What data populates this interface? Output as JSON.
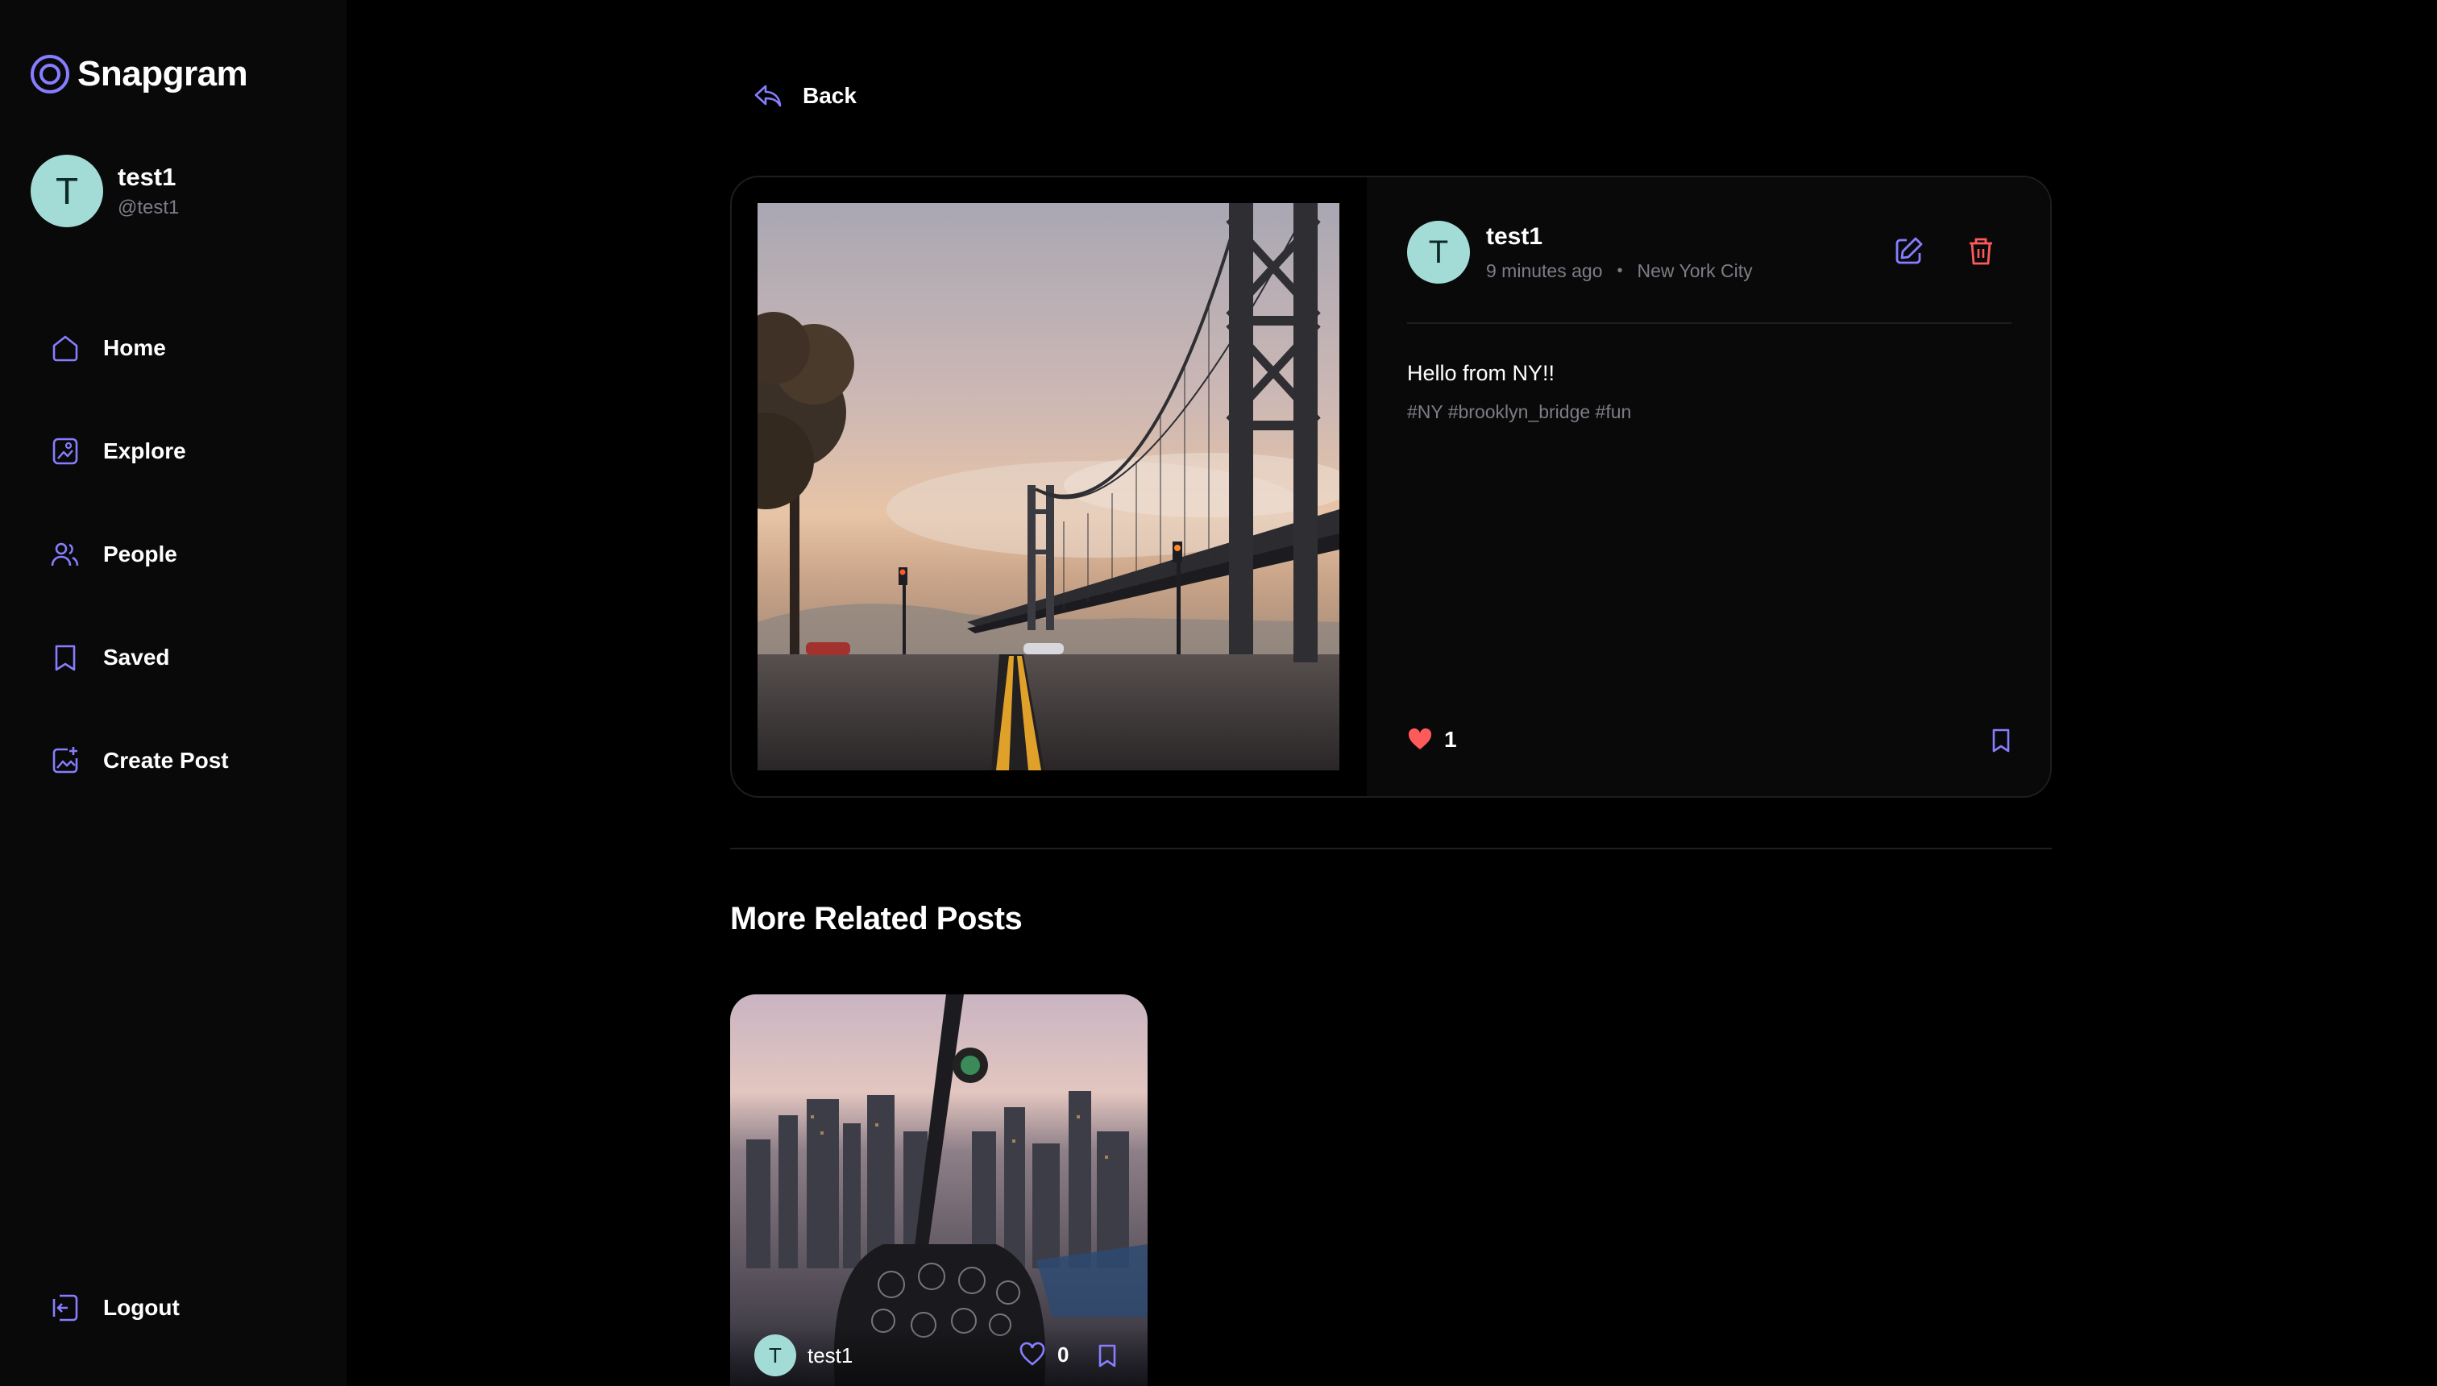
{
  "app": {
    "name": "Snapgram",
    "accent": "#877eff",
    "danger": "#ff5a5a"
  },
  "user": {
    "name": "test1",
    "handle": "@test1",
    "initial": "T"
  },
  "nav": [
    {
      "label": "Home",
      "icon": "home-icon"
    },
    {
      "label": "Explore",
      "icon": "explore-icon"
    },
    {
      "label": "People",
      "icon": "people-icon"
    },
    {
      "label": "Saved",
      "icon": "bookmark-icon"
    },
    {
      "label": "Create Post",
      "icon": "create-post-icon"
    }
  ],
  "logout": {
    "label": "Logout",
    "icon": "logout-icon"
  },
  "back": {
    "label": "Back"
  },
  "post": {
    "author": {
      "name": "test1",
      "initial": "T"
    },
    "time": "9 minutes ago",
    "location": "New York City",
    "separator": "•",
    "caption": "Hello from NY!!",
    "tags": "#NY #brooklyn_bridge #fun",
    "likes": "1"
  },
  "related": {
    "title": "More Related Posts",
    "items": [
      {
        "user": "test1",
        "initial": "T",
        "likes": "0"
      }
    ]
  }
}
